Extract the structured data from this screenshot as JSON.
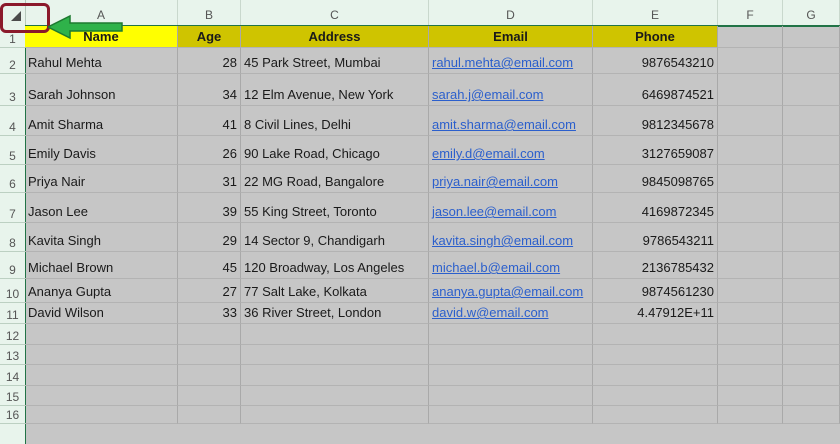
{
  "columns": [
    "A",
    "B",
    "C",
    "D",
    "E",
    "F",
    "G"
  ],
  "rows": [
    "1",
    "2",
    "3",
    "4",
    "5",
    "6",
    "7",
    "8",
    "9",
    "10",
    "11",
    "12",
    "13",
    "14",
    "15",
    "16"
  ],
  "header": {
    "name": "Name",
    "age": "Age",
    "address": "Address",
    "email": "Email",
    "phone": "Phone"
  },
  "records": [
    {
      "name": "Rahul Mehta",
      "age": "28",
      "address": "45 Park Street, Mumbai",
      "email": "rahul.mehta@email.com",
      "phone": "9876543210"
    },
    {
      "name": "Sarah Johnson",
      "age": "34",
      "address": "12 Elm Avenue, New York",
      "email": "sarah.j@email.com",
      "phone": "6469874521"
    },
    {
      "name": "Amit Sharma",
      "age": "41",
      "address": "8 Civil Lines, Delhi",
      "email": "amit.sharma@email.com",
      "phone": "9812345678"
    },
    {
      "name": "Emily Davis",
      "age": "26",
      "address": "90 Lake Road, Chicago",
      "email": "emily.d@email.com",
      "phone": "3127659087"
    },
    {
      "name": "Priya Nair",
      "age": "31",
      "address": "22 MG Road, Bangalore",
      "email": "priya.nair@email.com",
      "phone": "9845098765"
    },
    {
      "name": "Jason Lee",
      "age": "39",
      "address": "55 King Street, Toronto",
      "email": "jason.lee@email.com",
      "phone": "4169872345"
    },
    {
      "name": "Kavita Singh",
      "age": "29",
      "address": "14 Sector 9, Chandigarh",
      "email": "kavita.singh@email.com",
      "phone": "9786543211"
    },
    {
      "name": "Michael Brown",
      "age": "45",
      "address": "120 Broadway, Los Angeles",
      "email": "michael.b@email.com",
      "phone": "2136785432"
    },
    {
      "name": "Ananya Gupta",
      "age": "27",
      "address": "77 Salt Lake, Kolkata",
      "email": "ananya.gupta@email.com",
      "phone": "9874561230"
    },
    {
      "name": "David Wilson",
      "age": "33",
      "address": "36 River Street, London",
      "email": "david.w@email.com",
      "phone": "4.47912E+11"
    }
  ],
  "colors": {
    "header_yellow": "#ffff00",
    "header_olive": "#cfc400",
    "grid_bg": "#c6c6c6",
    "excel_green": "#217346",
    "callout_red": "#8b1a2b",
    "link_blue": "#2b5fcc"
  },
  "icons": {
    "corner": "select-all-triangle-icon",
    "callout": "left-arrow-icon"
  }
}
